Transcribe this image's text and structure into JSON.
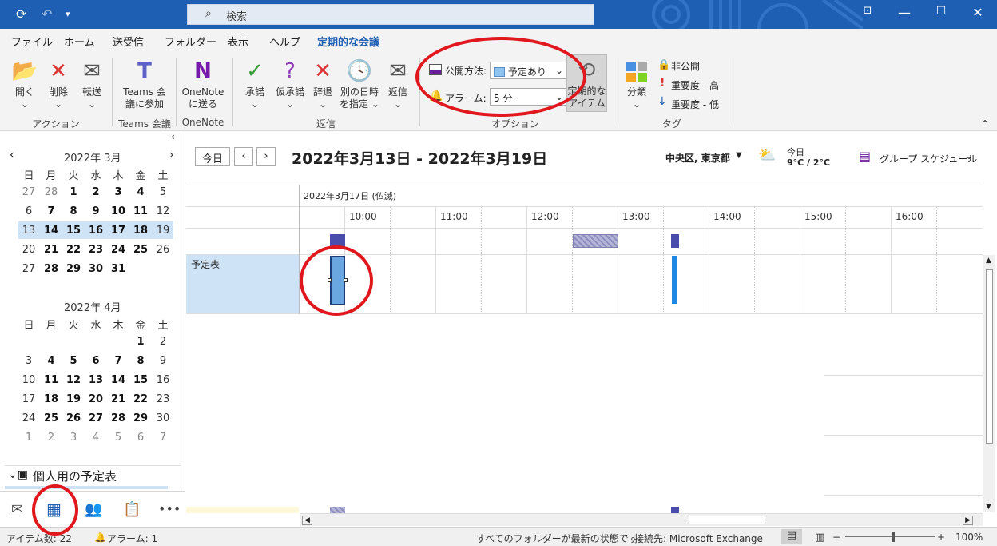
{
  "titlebar": {
    "search_placeholder": "検索"
  },
  "menu": [
    "ファイル",
    "ホーム",
    "送受信",
    "フォルダー",
    "表示",
    "ヘルプ"
  ],
  "menu_active": "定期的な会議",
  "ribbon": {
    "open": "開く",
    "delete": "削除",
    "forward": "転送",
    "group_action": "アクション",
    "teams_1": "Teams 会",
    "teams_2": "議に参加",
    "group_teams": "Teams 会議",
    "onenote_1": "OneNote",
    "onenote_2": "に送る",
    "group_onenote": "OneNote",
    "accept": "承諾",
    "tentative": "仮承諾",
    "decline": "辞退",
    "propose_1": "別の日時",
    "propose_2": "を指定",
    "reply": "返信",
    "group_reply": "返信",
    "show_as_label": "公開方法:",
    "show_as_value": "予定あり",
    "alarm_label": "アラーム:",
    "alarm_value": "5 分",
    "recurring_1": "定期的な",
    "recurring_2": "アイテム",
    "group_options": "オプション",
    "categorize": "分類",
    "private": "非公開",
    "high": "重要度 - 高",
    "low": "重要度 - 低",
    "group_tags": "タグ"
  },
  "mini_cal": {
    "march_title": "2022年 3月",
    "april_title": "2022年 4月",
    "weekdays": [
      "日",
      "月",
      "火",
      "水",
      "木",
      "金",
      "土"
    ],
    "march": [
      [
        "27",
        "28",
        "1",
        "2",
        "3",
        "4",
        "5"
      ],
      [
        "6",
        "7",
        "8",
        "9",
        "10",
        "11",
        "12"
      ],
      [
        "13",
        "14",
        "15",
        "16",
        "17",
        "18",
        "19"
      ],
      [
        "20",
        "21",
        "22",
        "23",
        "24",
        "25",
        "26"
      ],
      [
        "27",
        "28",
        "29",
        "30",
        "31",
        "",
        ""
      ]
    ],
    "april": [
      [
        "",
        "",
        "",
        "",
        "",
        "1",
        "2"
      ],
      [
        "3",
        "4",
        "5",
        "6",
        "7",
        "8",
        "9"
      ],
      [
        "10",
        "11",
        "12",
        "13",
        "14",
        "15",
        "16"
      ],
      [
        "17",
        "18",
        "19",
        "20",
        "21",
        "22",
        "23"
      ],
      [
        "24",
        "25",
        "26",
        "27",
        "28",
        "29",
        "30"
      ],
      [
        "1",
        "2",
        "3",
        "4",
        "5",
        "6",
        "7"
      ]
    ]
  },
  "folder_section": "個人用の予定表",
  "main": {
    "today": "今日",
    "range": "2022年3月13日 - 2022年3月19日",
    "location": "中央区, 東京都",
    "weather_day": "今日",
    "weather_temp": "9°C / 2°C",
    "view": "グループ スケジュール",
    "date_header": "2022年3月17日 (仏滅)",
    "times": [
      "10:00",
      "11:00",
      "12:00",
      "13:00",
      "14:00",
      "15:00",
      "16:00"
    ],
    "row_label": "予定表"
  },
  "status": {
    "items": "アイテム数: 22",
    "alarm": "アラーム: 1",
    "sync": "すべてのフォルダーが最新の状態です。",
    "connection": "接続先: Microsoft Exchange",
    "zoom": "100%"
  },
  "colors": {
    "accent": "#1e5fb4",
    "busy": "#4b4dad",
    "annotation": "#e0181e"
  }
}
